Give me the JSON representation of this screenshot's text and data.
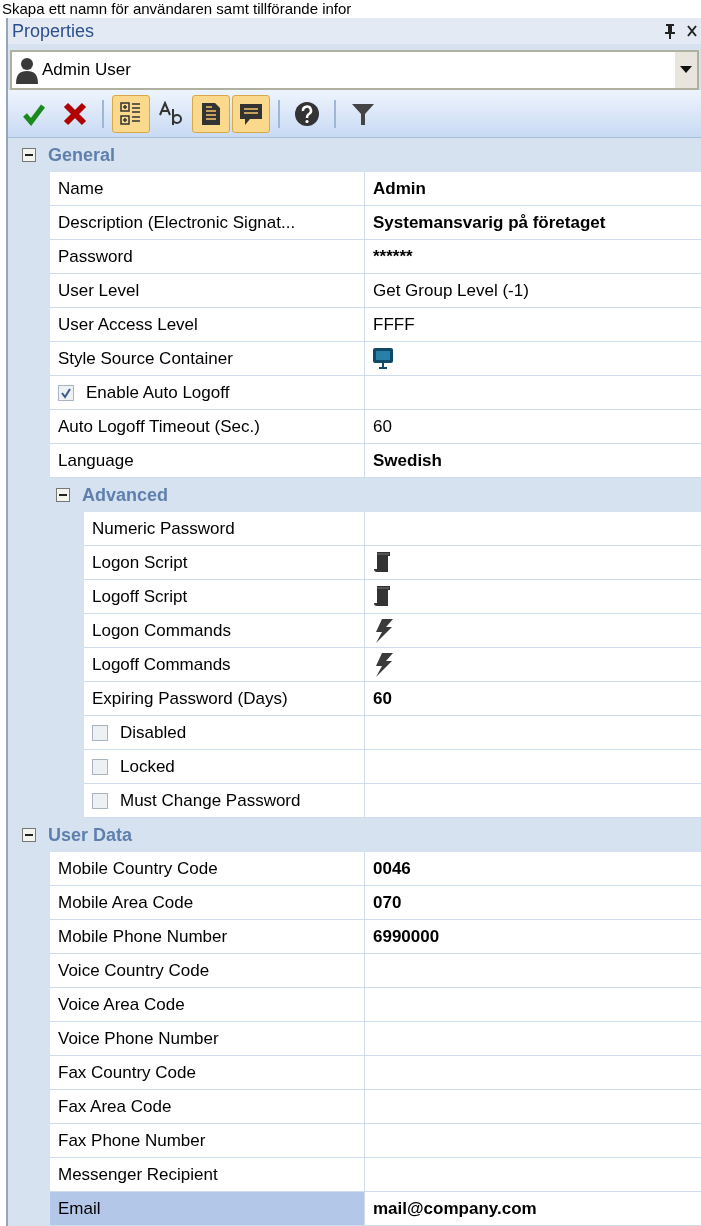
{
  "caption": "Skapa ett namn för användaren samt tillförande infor",
  "panel": {
    "title": "Properties"
  },
  "object_selector": {
    "value": "Admin User"
  },
  "toolbar": [
    {
      "kind": "check",
      "selected": false
    },
    {
      "kind": "cross",
      "selected": false
    },
    {
      "kind": "separator"
    },
    {
      "kind": "categorized",
      "selected": true
    },
    {
      "kind": "alphabetical",
      "selected": false
    },
    {
      "kind": "pages",
      "selected": true
    },
    {
      "kind": "description",
      "selected": true
    },
    {
      "kind": "separator"
    },
    {
      "kind": "help",
      "selected": false
    },
    {
      "kind": "separator"
    },
    {
      "kind": "filter",
      "selected": false
    }
  ],
  "categories": [
    {
      "label": "General",
      "expanded": true,
      "rows": [
        {
          "kind": "text",
          "label": "Name",
          "value": "Admin",
          "bold": true,
          "selected": false
        },
        {
          "kind": "text",
          "label": "Description (Electronic Signat...",
          "value": "Systemansvarig på företaget",
          "bold": true,
          "selected": false
        },
        {
          "kind": "text",
          "label": "Password",
          "value": "******",
          "bold": true,
          "selected": false
        },
        {
          "kind": "text",
          "label": "User Level",
          "value": "Get Group Level (-1)",
          "bold": false,
          "selected": false
        },
        {
          "kind": "text",
          "label": "User Access Level",
          "value": "FFFF",
          "bold": false,
          "selected": false
        },
        {
          "kind": "monitor",
          "label": "Style Source Container",
          "selected": false
        },
        {
          "kind": "checkbox",
          "label": "Enable Auto Logoff",
          "checked": true,
          "selected": false
        },
        {
          "kind": "text",
          "label": "Auto Logoff Timeout (Sec.)",
          "value": "60",
          "bold": false,
          "selected": false
        },
        {
          "kind": "text",
          "label": "Language",
          "value": "Swedish",
          "bold": true,
          "selected": false
        }
      ],
      "subcategories": [
        {
          "label": "Advanced",
          "expanded": true,
          "rows": [
            {
              "kind": "text",
              "label": "Numeric Password",
              "selected": false
            },
            {
              "kind": "script",
              "label": "Logon Script",
              "selected": false
            },
            {
              "kind": "script",
              "label": "Logoff Script",
              "selected": false
            },
            {
              "kind": "bolt",
              "label": "Logon Commands",
              "selected": false
            },
            {
              "kind": "bolt",
              "label": "Logoff Commands",
              "selected": false
            },
            {
              "kind": "text",
              "label": "Expiring Password (Days)",
              "value": "60",
              "bold": true,
              "selected": false
            },
            {
              "kind": "checkbox",
              "label": "Disabled",
              "checked": false,
              "selected": false
            },
            {
              "kind": "checkbox",
              "label": "Locked",
              "checked": false,
              "selected": false
            },
            {
              "kind": "checkbox",
              "label": "Must Change Password",
              "checked": false,
              "selected": false
            }
          ]
        }
      ]
    },
    {
      "label": "User Data",
      "expanded": true,
      "rows": [
        {
          "kind": "text",
          "label": "Mobile Country Code",
          "value": "0046",
          "bold": true,
          "selected": false
        },
        {
          "kind": "text",
          "label": "Mobile Area Code",
          "value": "070",
          "bold": true,
          "selected": false
        },
        {
          "kind": "text",
          "label": "Mobile Phone Number",
          "value": "6990000",
          "bold": true,
          "selected": false
        },
        {
          "kind": "text",
          "label": "Voice Country Code",
          "selected": false
        },
        {
          "kind": "text",
          "label": "Voice Area Code",
          "selected": false
        },
        {
          "kind": "text",
          "label": "Voice Phone Number",
          "selected": false
        },
        {
          "kind": "text",
          "label": "Fax Country Code",
          "selected": false
        },
        {
          "kind": "text",
          "label": "Fax Area Code",
          "selected": false
        },
        {
          "kind": "text",
          "label": "Fax Phone Number",
          "selected": false
        },
        {
          "kind": "text",
          "label": "Messenger Recipient",
          "selected": false
        },
        {
          "kind": "text",
          "label": "Email",
          "value": "mail@company.com",
          "bold": true,
          "selected": true
        }
      ]
    }
  ]
}
